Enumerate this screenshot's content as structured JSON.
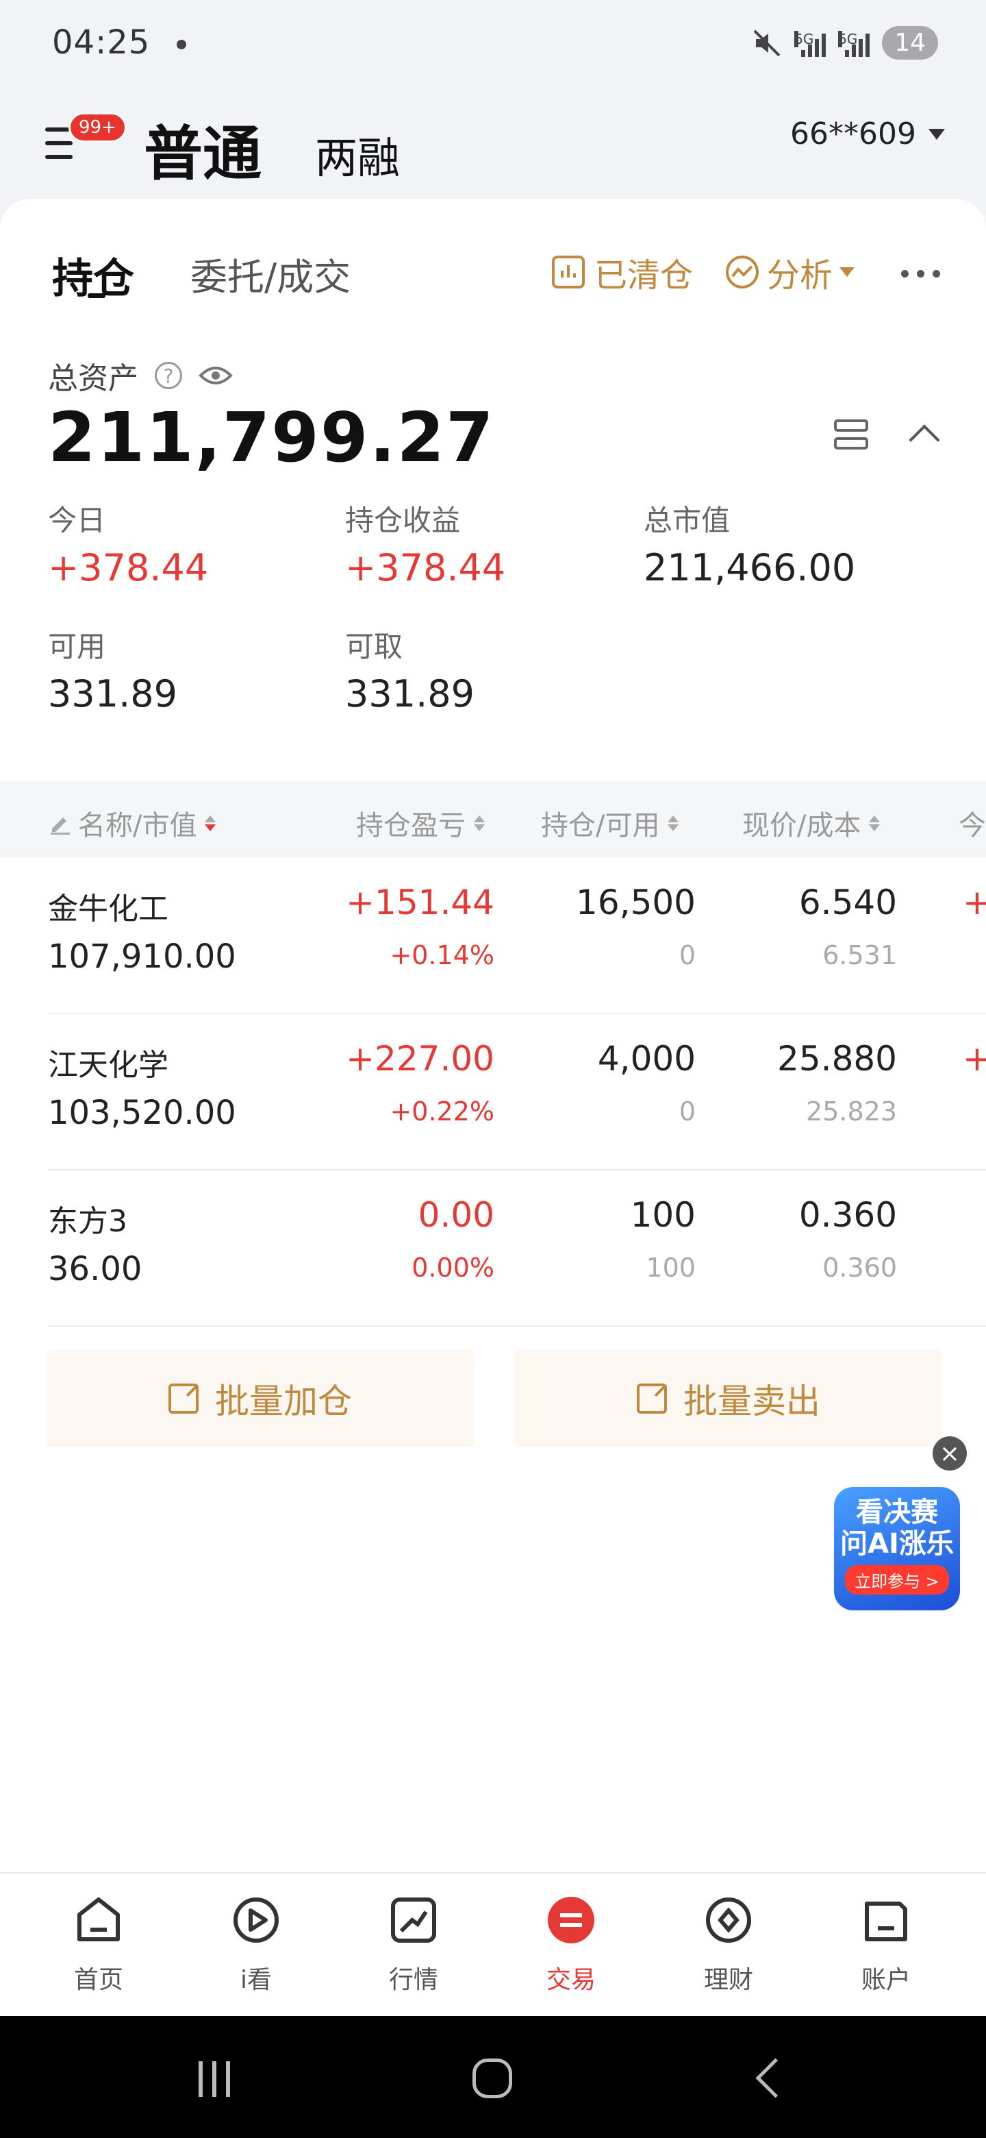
{
  "status_bar": {
    "time": "04:25",
    "net1": "5G",
    "net2": "5G",
    "battery": "14"
  },
  "header": {
    "notif_badge": "99+",
    "tab_normal": "普通",
    "tab_margin": "两融",
    "account": "66**609"
  },
  "tabs": {
    "holdings": "持仓",
    "orders": "委托/成交",
    "cleared": "已清仓",
    "analysis": "分析"
  },
  "assets": {
    "total_label": "总资产",
    "help": "?",
    "total_value": "211,799.27",
    "today_label": "今日",
    "today_value": "+378.44",
    "holding_pl_label": "持仓收益",
    "holding_pl_value": "+378.44",
    "market_value_label": "总市值",
    "market_value_value": "211,466.00",
    "available_label": "可用",
    "available_value": "331.89",
    "withdrawable_label": "可取",
    "withdrawable_value": "331.89"
  },
  "table": {
    "headers": {
      "name": "名称/市值",
      "pl": "持仓盈亏",
      "position": "持仓/可用",
      "price": "现价/成本",
      "today": "今"
    },
    "rows": [
      {
        "name": "金牛化工",
        "market_value": "107,910.00",
        "pl": "+151.44",
        "pl_pct": "+0.14%",
        "position": "16,500",
        "available": "0",
        "price": "6.540",
        "cost": "6.531",
        "edge": "+"
      },
      {
        "name": "江天化学",
        "market_value": "103,520.00",
        "pl": "+227.00",
        "pl_pct": "+0.22%",
        "position": "4,000",
        "available": "0",
        "price": "25.880",
        "cost": "25.823",
        "edge": "+"
      },
      {
        "name": "东方3",
        "market_value": "36.00",
        "pl": "0.00",
        "pl_pct": "0.00%",
        "position": "100",
        "available": "100",
        "price": "0.360",
        "cost": "0.360",
        "edge": ""
      }
    ]
  },
  "actions": {
    "batch_add": "批量加仓",
    "batch_sell": "批量卖出"
  },
  "ad": {
    "close": "×",
    "line1": "看决赛",
    "line2": "问AI涨乐",
    "cta": "立即参与 >"
  },
  "bottom_nav": [
    {
      "label": "首页"
    },
    {
      "label": "i看"
    },
    {
      "label": "行情"
    },
    {
      "label": "交易"
    },
    {
      "label": "理财"
    },
    {
      "label": "账户"
    }
  ],
  "colors": {
    "up": "#e53935",
    "accent": "#c08a3e",
    "active_nav": "#e53935"
  }
}
